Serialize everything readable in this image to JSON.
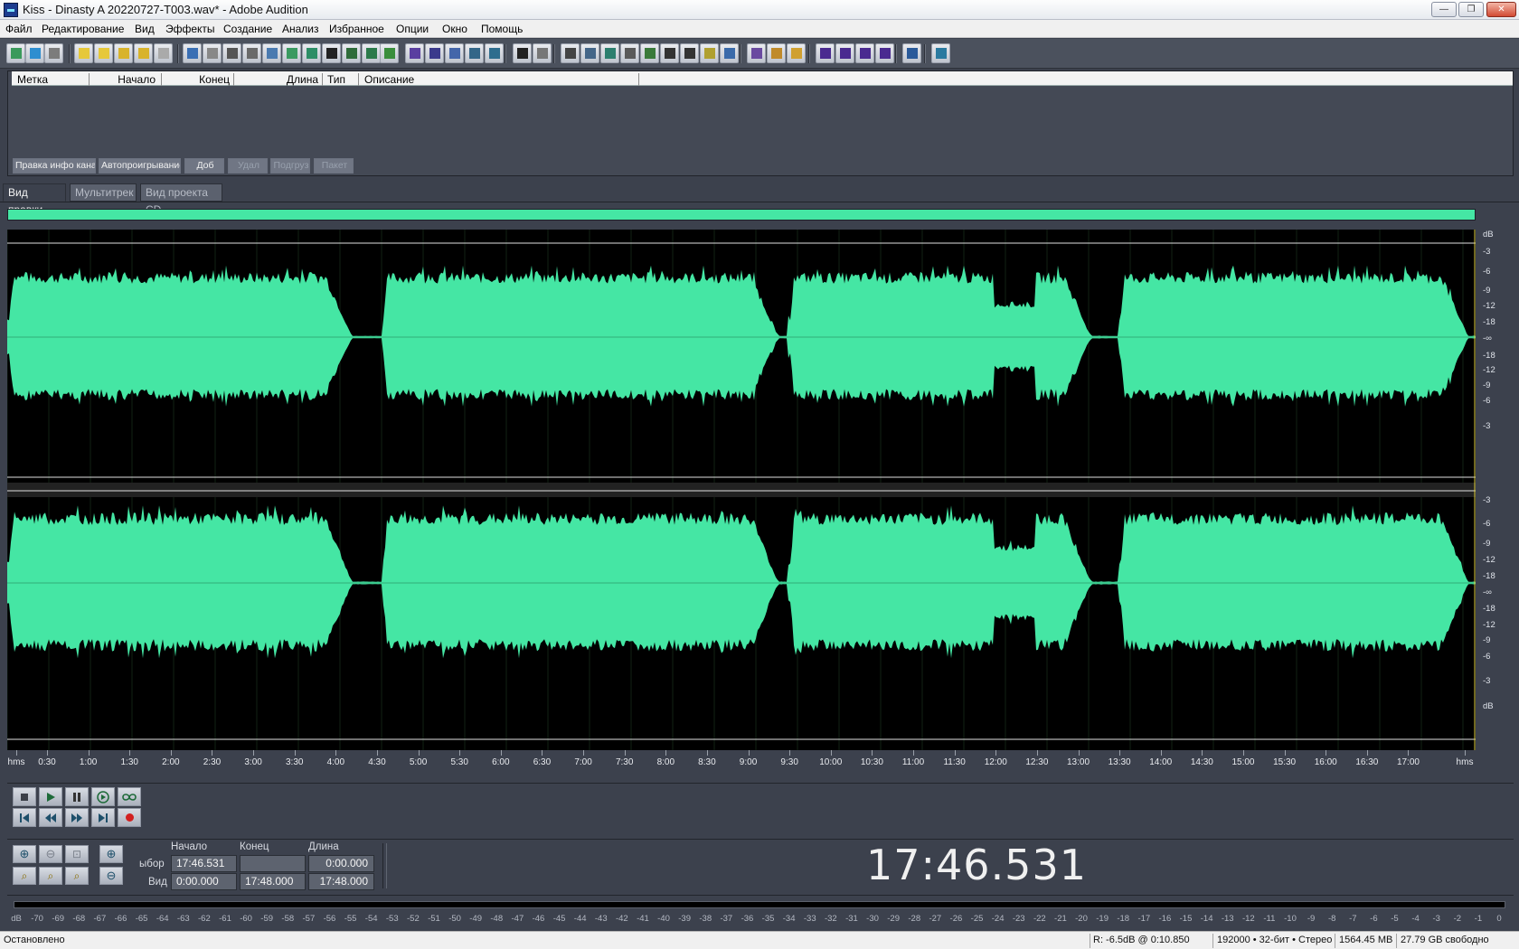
{
  "window": {
    "title": "Kiss - Dinasty  A 20220727-T003.wav* - Adobe Audition",
    "minimize": "—",
    "maximize": "❐",
    "close": "✕"
  },
  "menu": [
    "Файл",
    "Редактирование",
    "Вид",
    "Эффекты",
    "Создание",
    "Анализ",
    "Избранное",
    "Опции",
    "Окно",
    "Помощь"
  ],
  "cue_list": {
    "columns": [
      "Метка",
      "Начало",
      "Конец",
      "Длина",
      "Тип",
      "Описание"
    ],
    "buttons": {
      "edit_info": "Правка инфо канала",
      "autoplay": "Автопроигрывание",
      "add": "Доб",
      "delete": "Удал",
      "merge": "Подгруз",
      "batch": "Пакет"
    }
  },
  "tabs": [
    "Вид правки",
    "Мультитрек",
    "Вид проекта CD"
  ],
  "db_scale_top": [
    "dB",
    "-3",
    "-6",
    "-9",
    "-12",
    "-18",
    "-∞",
    "-18",
    "-12",
    "-9",
    "-6",
    "-3"
  ],
  "db_scale_bottom": [
    "-3",
    "-6",
    "-9",
    "-12",
    "-18",
    "-∞",
    "-18",
    "-12",
    "-9",
    "-6",
    "-3",
    "dB"
  ],
  "timeline": [
    "hms",
    "0:30",
    "1:00",
    "1:30",
    "2:00",
    "2:30",
    "3:00",
    "3:30",
    "4:00",
    "4:30",
    "5:00",
    "5:30",
    "6:00",
    "6:30",
    "7:00",
    "7:30",
    "8:00",
    "8:30",
    "9:00",
    "9:30",
    "10:00",
    "10:30",
    "11:00",
    "11:30",
    "12:00",
    "12:30",
    "13:00",
    "13:30",
    "14:00",
    "14:30",
    "15:00",
    "15:30",
    "16:00",
    "16:30",
    "17:00",
    "hms"
  ],
  "selection": {
    "headers": {
      "start": "Начало",
      "end": "Конец",
      "length": "Длина"
    },
    "row_selection_label": "ыбор",
    "row_view_label": "Вид",
    "selection": {
      "start": "17:46.531",
      "end": "",
      "length": "0:00.000"
    },
    "view": {
      "start": "0:00.000",
      "end": "17:48.000",
      "length": "17:48.000"
    }
  },
  "current_time": "17:46.531",
  "level_meter": [
    "dB",
    "-70",
    "-69",
    "-68",
    "-67",
    "-66",
    "-65",
    "-64",
    "-63",
    "-62",
    "-61",
    "-60",
    "-59",
    "-58",
    "-57",
    "-56",
    "-55",
    "-54",
    "-53",
    "-52",
    "-51",
    "-50",
    "-49",
    "-48",
    "-47",
    "-46",
    "-45",
    "-44",
    "-43",
    "-42",
    "-41",
    "-40",
    "-39",
    "-38",
    "-37",
    "-36",
    "-35",
    "-34",
    "-33",
    "-32",
    "-31",
    "-30",
    "-29",
    "-28",
    "-27",
    "-26",
    "-25",
    "-24",
    "-23",
    "-22",
    "-21",
    "-20",
    "-19",
    "-18",
    "-17",
    "-16",
    "-15",
    "-14",
    "-13",
    "-12",
    "-11",
    "-10",
    "-9",
    "-8",
    "-7",
    "-6",
    "-5",
    "-4",
    "-3",
    "-2",
    "-1",
    "0"
  ],
  "status": {
    "state": "Остановлено",
    "level": "R: -6.5dB @  0:10.850",
    "format": "192000 • 32-бит • Стерео",
    "size": "1564.45 MB",
    "free": "27.79 GB свободно"
  },
  "colors": {
    "waveform": "#45e6a4",
    "background": "#3c414d",
    "wave_bg": "#000000"
  }
}
